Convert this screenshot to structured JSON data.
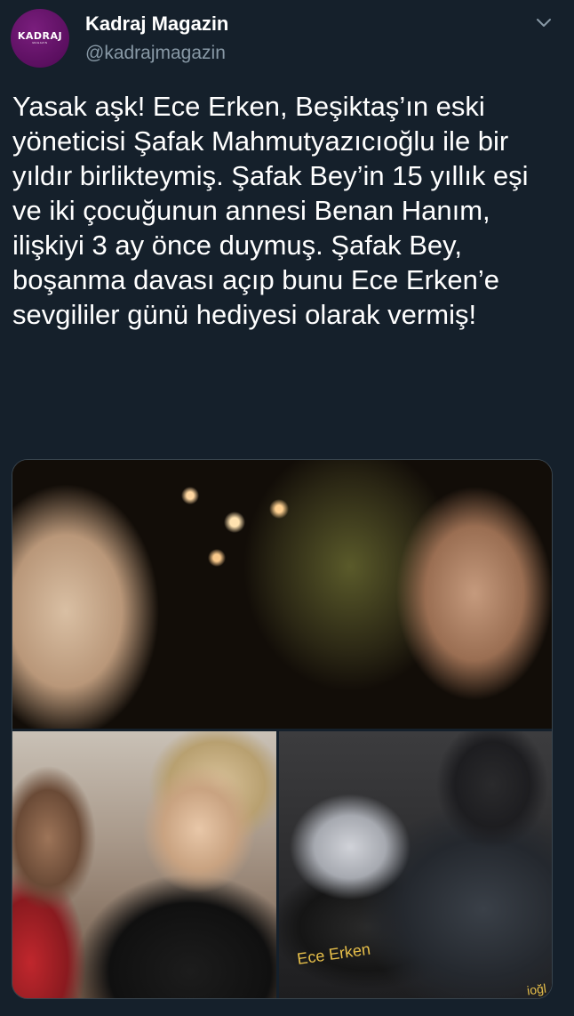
{
  "author": {
    "name": "Kadraj Magazin",
    "handle": "@kadrajmagazin",
    "avatar_logo": "KADRAJ",
    "avatar_sub": "MAGAZIN"
  },
  "menu_icon": "chevron-down-icon",
  "tweet": {
    "text": "Yasak aşk! Ece Erken, Beşiktaş’ın eski yöneticisi Şafak Mahmutyazıcıoğlu ile bir yıldır birlikteymiş. Şafak Bey’in 15 yıllık eşi ve iki çocuğunun annesi Benan Hanım, ilişkiyi 3 ay önce duymuş. Şafak Bey, boşanma davası açıp bunu Ece Erken’e sevgililer günü hediyesi olarak vermiş!"
  },
  "media": {
    "photo_caption": "Ece Erken",
    "photo_caption_partial": "ioğl"
  },
  "colors": {
    "background": "#15202b",
    "text": "#ffffff",
    "secondary": "#8899a6",
    "avatar": "#5b0f60"
  }
}
